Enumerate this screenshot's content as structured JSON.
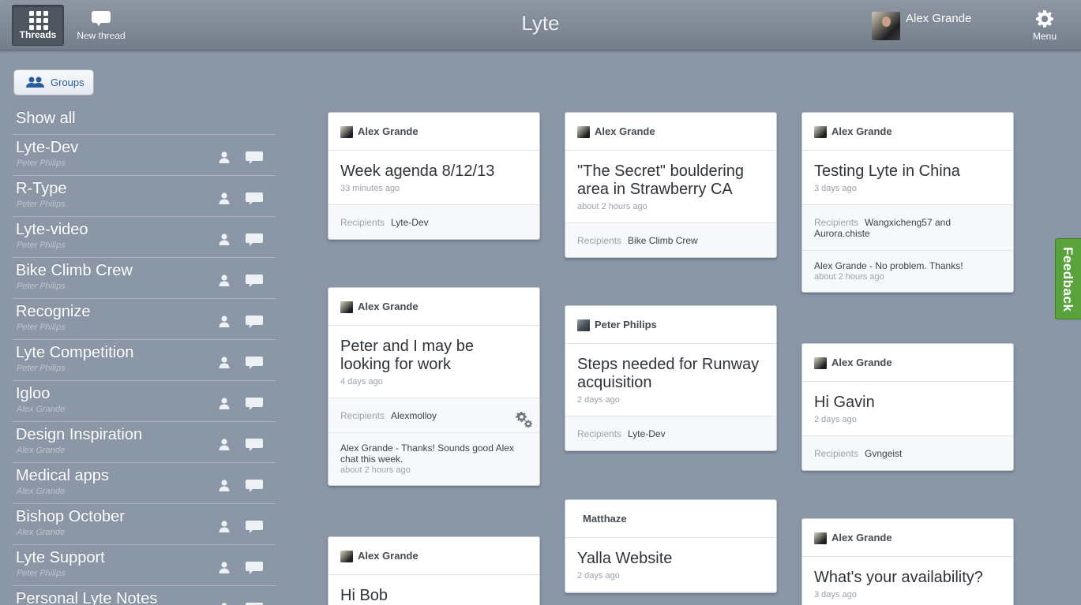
{
  "topbar": {
    "threads_label": "Threads",
    "new_thread_label": "New thread",
    "app_title": "Lyte",
    "user_name": "Alex Grande",
    "menu_label": "Menu"
  },
  "sidebar": {
    "groups_label": "Groups",
    "show_all": "Show all",
    "items": [
      {
        "name": "Lyte-Dev",
        "owner": "Peter Philips"
      },
      {
        "name": "R-Type",
        "owner": "Peter Philips"
      },
      {
        "name": "Lyte-video",
        "owner": "Peter Philips"
      },
      {
        "name": "Bike Climb Crew",
        "owner": "Peter Philips"
      },
      {
        "name": "Recognize",
        "owner": "Peter Philips"
      },
      {
        "name": "Lyte Competition",
        "owner": "Peter Philips"
      },
      {
        "name": "Igloo",
        "owner": "Alex Grande"
      },
      {
        "name": "Design Inspiration",
        "owner": "Alex Grande"
      },
      {
        "name": "Medical apps",
        "owner": "Alex Grande"
      },
      {
        "name": "Bishop October",
        "owner": "Alex Grande"
      },
      {
        "name": "Lyte Support",
        "owner": "Peter Philips"
      },
      {
        "name": "Personal Lyte Notes",
        "owner": ""
      }
    ]
  },
  "labels": {
    "recipients": "Recipients"
  },
  "cards": [
    {
      "author": "Alex Grande",
      "title": "Week agenda 8/12/13",
      "time": "33 minutes ago",
      "recipients": "Lyte-Dev"
    },
    {
      "author": "Alex Grande",
      "title": "\"The Secret\" bouldering area in Strawberry CA",
      "time": "about 2 hours ago",
      "recipients": "Bike Climb Crew"
    },
    {
      "author": "Alex Grande",
      "title": "Testing Lyte in China",
      "time": "3 days ago",
      "recipients": "Wangxicheng57 and Aurora.chiste",
      "last_message": "Alex Grande - No problem. Thanks!",
      "last_message_time": "about 2 hours ago"
    },
    {
      "author": "Alex Grande",
      "title": "Peter and I may be looking for work",
      "time": "4 days ago",
      "recipients": "Alexmolloy",
      "last_message": "Alex Grande - Thanks! Sounds good Alex chat this week.",
      "last_message_time": "about 2 hours ago"
    },
    {
      "author": "Peter Philips",
      "title": "Steps needed for Runway acquisition",
      "time": "2 days ago",
      "recipients": "Lyte-Dev"
    },
    {
      "author": "Alex Grande",
      "title": "Hi Gavin",
      "time": "2 days ago",
      "recipients": "Gvngeist"
    },
    {
      "author": "Alex Grande",
      "title": "Hi Bob"
    },
    {
      "author": "Matthaze",
      "title": "Yalla Website",
      "time": "2 days ago"
    },
    {
      "author": "Alex Grande",
      "title": "What's your availability?",
      "time": "3 days ago"
    }
  ],
  "feedback_label": "Feedback"
}
